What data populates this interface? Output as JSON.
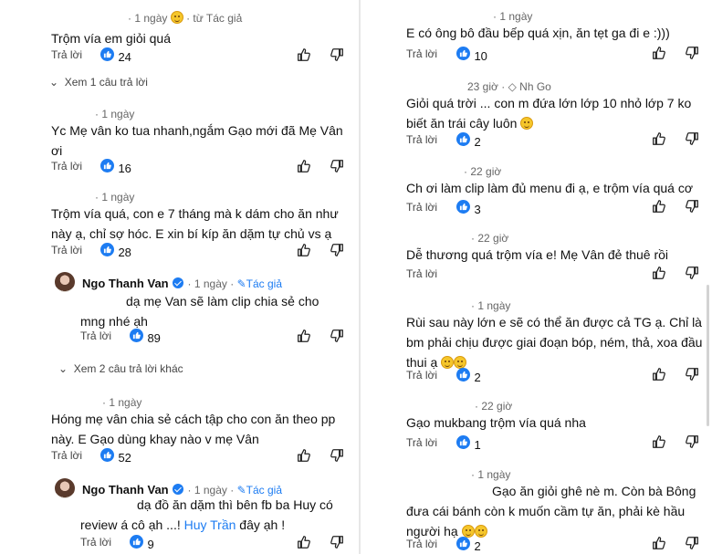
{
  "reply_label": "Trả lời",
  "left": {
    "c1": {
      "time": "1 ngày",
      "from_author": "từ Tác giả",
      "text": "Trộm vía em giỏi quá",
      "likes": "24"
    },
    "c1_more": "Xem 1 câu trả lời",
    "c2": {
      "time": "1 ngày",
      "text_line1": "Yc Mẹ vân ko tua nhanh,ngắm Gạo mới đã Mẹ Vân",
      "text_line2": "ơi",
      "likes": "16"
    },
    "c3": {
      "time": "1 ngày",
      "text_line1": "Trộm vía quá, con e 7 tháng mà k dám cho ăn như",
      "text_line2": "này ạ, chỉ sợ hóc. E xin bí kíp ăn dặm tự chủ vs ạ",
      "likes": "28"
    },
    "r1": {
      "name": "Ngo Thanh Van",
      "time": "1 ngày",
      "author_label": "Tác giả",
      "text_line1": "dạ mẹ Van sẽ làm clip chia sẻ cho",
      "text_line2": "mng nhé ạh",
      "likes": "89"
    },
    "r1_more": "Xem 2 câu trả lời khác",
    "c4": {
      "time": "1 ngày",
      "text_line1": "Hóng mẹ vân chia sẻ cách tập cho con ăn theo pp",
      "text_line2": "này. E Gạo dùng khay nào v mẹ Vân",
      "likes": "52"
    },
    "r2": {
      "name": "Ngo Thanh Van",
      "time": "1 ngày",
      "author_label": "Tác giả",
      "text_line1": "dạ đồ ăn dặm thì bên fb ba Huy có",
      "text_line2a": "review á cô ạh ...! ",
      "mention": "Huy Trần",
      "text_line2b": " đây ạh !",
      "likes": "9"
    }
  },
  "right": {
    "c1": {
      "time": "1 ngày",
      "text": "E có ông bô đầu bếp quá xịn, ăn tẹt ga đi e :)))",
      "likes": "10"
    },
    "c2": {
      "time": "23 giờ",
      "badge": "Nh Go",
      "text_line1": "Giỏi quá trời ... con m đứa lớn lớp 10 nhỏ lớp 7 ko",
      "text_line2": "biết ăn trái cây luôn",
      "likes": "2"
    },
    "c3": {
      "time": "22 giờ",
      "text": "Ch ơi làm clip làm đủ menu đi ạ, e trộm vía quá cơ",
      "likes": "3"
    },
    "c4": {
      "time": "22 giờ",
      "text": "Dễ thương quá trộm vía e! Mẹ Vân đẻ thuê rồi"
    },
    "c5": {
      "time": "1 ngày",
      "text_line1": "Rùi sau này lớn e sẽ có thể ăn được cả TG ạ. Chỉ là",
      "text_line2": "bm phải chịu được giai đoạn bóp, ném, thả, xoa đầu",
      "text_line3": "thui ạ",
      "likes": "2"
    },
    "c6": {
      "time": "22 giờ",
      "text": "Gạo mukbang trộm vía quá nha",
      "likes": "1"
    },
    "c7": {
      "time": "1 ngày",
      "text_line1": "Gạo ăn giỏi ghê nè m. Còn bà Bông",
      "text_line2": "đưa cái bánh còn k muốn cầm tự ăn, phải kè hầu",
      "text_line3": "người hạ",
      "likes": "2"
    }
  }
}
